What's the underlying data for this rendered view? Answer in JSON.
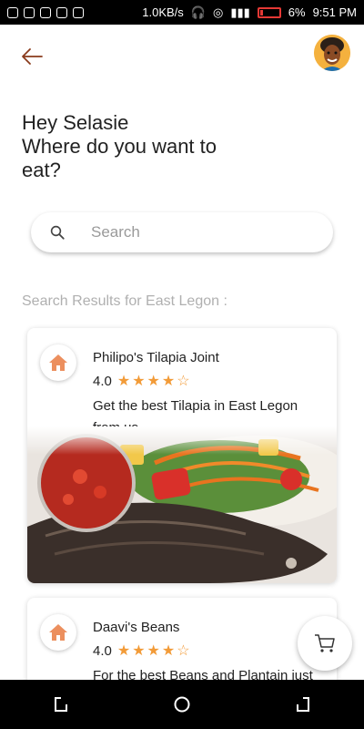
{
  "status_bar": {
    "network_speed": "1.0KB/s",
    "battery_percent": "6%",
    "time": "9:51 PM"
  },
  "header": {
    "greeting_line1": "Hey Selasie",
    "greeting_line2": "Where do you want to",
    "greeting_line3": "eat?"
  },
  "search": {
    "placeholder": "Search"
  },
  "results_label": "Search Results for East Legon :",
  "restaurants": [
    {
      "name": "Philipo's Tilapia Joint",
      "rating": "4.0",
      "stars": "★★★★☆",
      "description": "Get the best Tilapia in East Legon from us."
    },
    {
      "name": "Daavi's Beans",
      "rating": "4.0",
      "stars": "★★★★☆",
      "description": "For the best Beans and Plantain just"
    }
  ],
  "colors": {
    "accent": "#f29b38",
    "back_arrow": "#8a3b1c"
  }
}
